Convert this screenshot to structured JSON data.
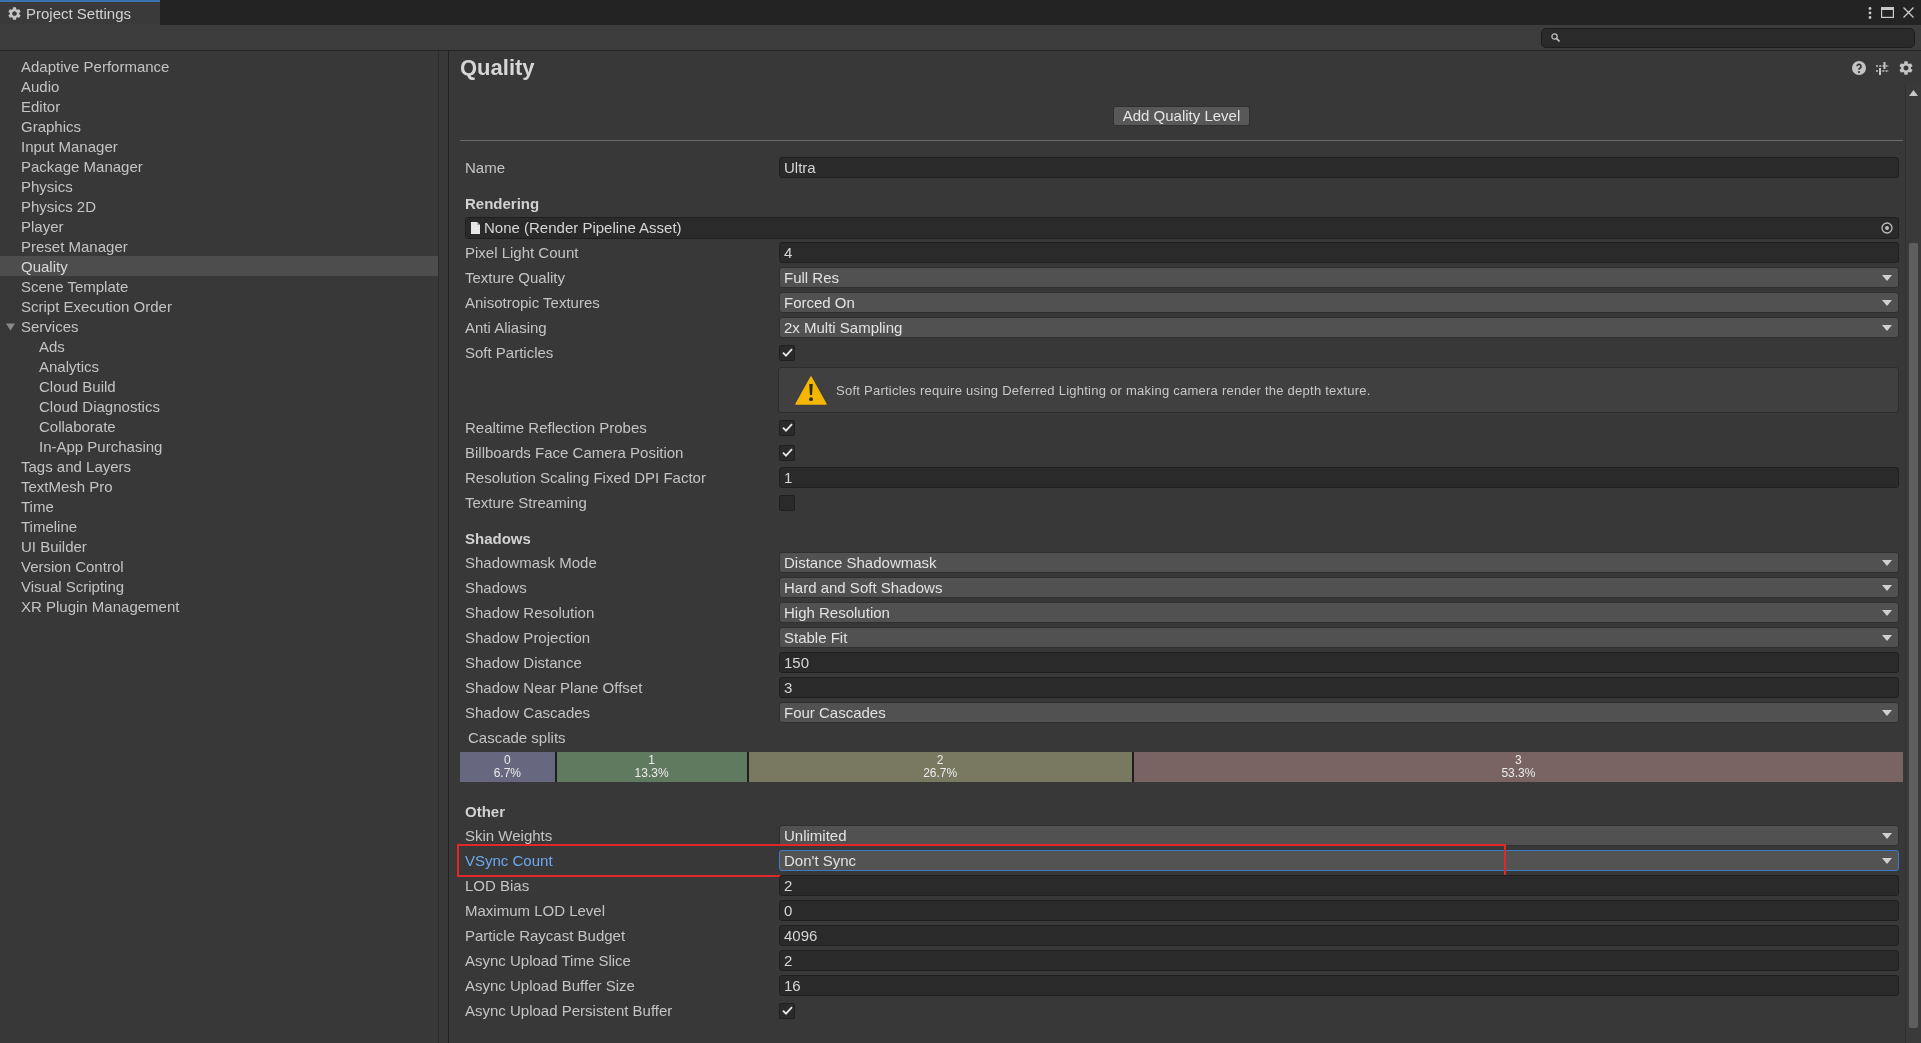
{
  "window": {
    "title": "Project Settings"
  },
  "sidebar": {
    "items": [
      {
        "label": "Adaptive Performance",
        "selected": false
      },
      {
        "label": "Audio",
        "selected": false
      },
      {
        "label": "Editor",
        "selected": false
      },
      {
        "label": "Graphics",
        "selected": false
      },
      {
        "label": "Input Manager",
        "selected": false
      },
      {
        "label": "Package Manager",
        "selected": false
      },
      {
        "label": "Physics",
        "selected": false
      },
      {
        "label": "Physics 2D",
        "selected": false
      },
      {
        "label": "Player",
        "selected": false
      },
      {
        "label": "Preset Manager",
        "selected": false
      },
      {
        "label": "Quality",
        "selected": true
      },
      {
        "label": "Scene Template",
        "selected": false
      },
      {
        "label": "Script Execution Order",
        "selected": false
      },
      {
        "label": "Services",
        "selected": false,
        "expanded": true,
        "children": [
          {
            "label": "Ads",
            "selected": false
          },
          {
            "label": "Analytics",
            "selected": false
          },
          {
            "label": "Cloud Build",
            "selected": false
          },
          {
            "label": "Cloud Diagnostics",
            "selected": false
          },
          {
            "label": "Collaborate",
            "selected": false
          },
          {
            "label": "In-App Purchasing",
            "selected": false
          }
        ]
      },
      {
        "label": "Tags and Layers",
        "selected": false
      },
      {
        "label": "TextMesh Pro",
        "selected": false
      },
      {
        "label": "Time",
        "selected": false
      },
      {
        "label": "Timeline",
        "selected": false
      },
      {
        "label": "UI Builder",
        "selected": false
      },
      {
        "label": "Version Control",
        "selected": false
      },
      {
        "label": "Visual Scripting",
        "selected": false
      },
      {
        "label": "XR Plugin Management",
        "selected": false
      }
    ]
  },
  "page": {
    "title": "Quality",
    "add_button": "Add Quality Level",
    "name_field": {
      "label": "Name",
      "value": "Ultra"
    },
    "sections": [
      {
        "title": "Rendering",
        "rows": [
          {
            "kind": "object",
            "value": "None (Render Pipeline Asset)"
          },
          {
            "kind": "text",
            "label": "Pixel Light Count",
            "value": "4"
          },
          {
            "kind": "dropdown",
            "label": "Texture Quality",
            "value": "Full Res"
          },
          {
            "kind": "dropdown",
            "label": "Anisotropic Textures",
            "value": "Forced On"
          },
          {
            "kind": "dropdown",
            "label": "Anti Aliasing",
            "value": "2x Multi Sampling"
          },
          {
            "kind": "checkbox",
            "label": "Soft Particles",
            "checked": true
          },
          {
            "kind": "warning",
            "text": "Soft Particles require using Deferred Lighting or making camera render the depth texture."
          },
          {
            "kind": "checkbox",
            "label": "Realtime Reflection Probes",
            "checked": true
          },
          {
            "kind": "checkbox",
            "label": "Billboards Face Camera Position",
            "checked": true
          },
          {
            "kind": "text",
            "label": "Resolution Scaling Fixed DPI Factor",
            "value": "1"
          },
          {
            "kind": "checkbox",
            "label": "Texture Streaming",
            "checked": false
          }
        ]
      },
      {
        "title": "Shadows",
        "rows": [
          {
            "kind": "dropdown",
            "label": "Shadowmask Mode",
            "value": "Distance Shadowmask"
          },
          {
            "kind": "dropdown",
            "label": "Shadows",
            "value": "Hard and Soft Shadows"
          },
          {
            "kind": "dropdown",
            "label": "Shadow Resolution",
            "value": "High Resolution"
          },
          {
            "kind": "dropdown",
            "label": "Shadow Projection",
            "value": "Stable Fit"
          },
          {
            "kind": "text",
            "label": "Shadow Distance",
            "value": "150"
          },
          {
            "kind": "text",
            "label": "Shadow Near Plane Offset",
            "value": "3"
          },
          {
            "kind": "dropdown",
            "label": "Shadow Cascades",
            "value": "Four Cascades"
          },
          {
            "kind": "splits",
            "label": "Cascade splits",
            "segments": [
              {
                "index": "0",
                "share": "6.7%",
                "level": 0.067,
                "color": "#67677f"
              },
              {
                "index": "1",
                "share": "13.3%",
                "level": 0.133,
                "color": "#607a60"
              },
              {
                "index": "2",
                "share": "26.7%",
                "level": 0.267,
                "color": "#797962"
              },
              {
                "index": "3",
                "share": "53.3%",
                "level": 0.533,
                "color": "#796363"
              }
            ]
          }
        ]
      },
      {
        "title": "Other",
        "rows": [
          {
            "kind": "dropdown",
            "label": "Skin Weights",
            "value": "Unlimited",
            "focused": false,
            "highlighted": false
          },
          {
            "kind": "dropdown",
            "label": "VSync Count",
            "value": "Don't Sync",
            "focused": true,
            "highlighted": true
          },
          {
            "kind": "text",
            "label": "LOD Bias",
            "value": "2",
            "focused": false,
            "highlighted": false
          },
          {
            "kind": "text",
            "label": "Maximum LOD Level",
            "value": "0",
            "focused": false,
            "highlighted": false
          },
          {
            "kind": "text",
            "label": "Particle Raycast Budget",
            "value": "4096",
            "focused": false,
            "highlighted": false
          },
          {
            "kind": "text",
            "label": "Async Upload Time Slice",
            "value": "2",
            "focused": false,
            "highlighted": false
          },
          {
            "kind": "text",
            "label": "Async Upload Buffer Size",
            "value": "16",
            "focused": false,
            "highlighted": false
          },
          {
            "kind": "checkbox",
            "label": "Async Upload Persistent Buffer",
            "checked": true,
            "focused": false,
            "highlighted": false
          }
        ]
      }
    ]
  }
}
